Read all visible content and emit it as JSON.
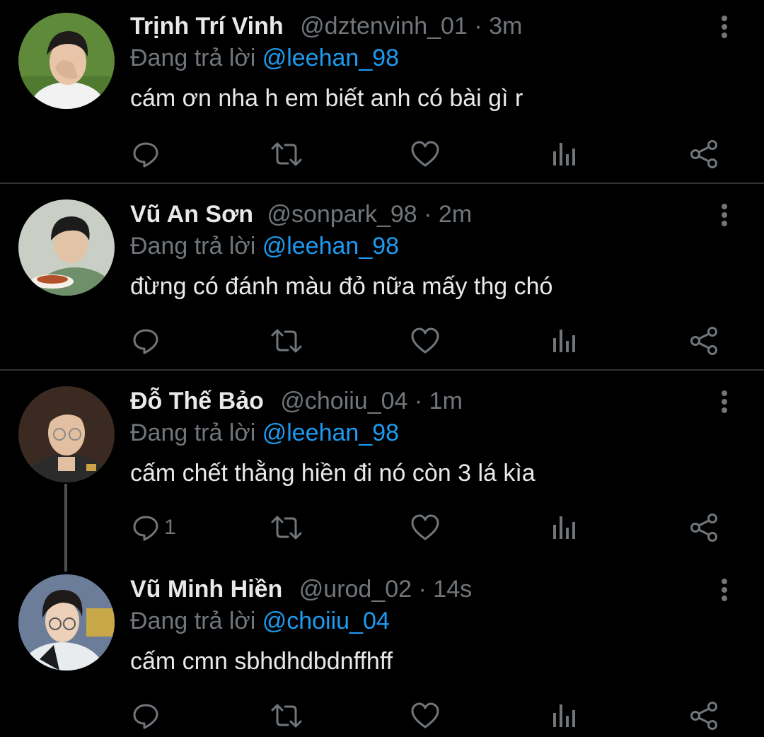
{
  "tweets": [
    {
      "name": "Trịnh Trí Vinh",
      "handle": "@dztenvinh_01",
      "dot": " · ",
      "time": "3m",
      "replying_prefix": "Đang trả lời ",
      "replying_to": "@leehan_98",
      "text": "cám ơn nha h em biết anh có bài gì r",
      "reply_count": "",
      "avatar_colors": {
        "bg": "#5f8a3a",
        "skin": "#e8c5a8",
        "hair": "#1f1b1a",
        "shirt": "#f2f2f2"
      }
    },
    {
      "name": "Vũ An Sơn",
      "handle": "@sonpark_98",
      "dot": " · ",
      "time": "2m",
      "replying_prefix": "Đang trả lời ",
      "replying_to": "@leehan_98",
      "text": "đừng có đánh màu đỏ nữa mấy thg chó",
      "reply_count": "",
      "avatar_colors": {
        "bg": "#c9cfc4",
        "skin": "#e3c3a6",
        "hair": "#1c1c1c",
        "shirt": "#6f8f6a"
      }
    },
    {
      "name": "Đỗ Thế Bảo",
      "handle": "@choiiu_04",
      "dot": " · ",
      "time": "1m",
      "replying_prefix": "Đang trả lời ",
      "replying_to": "@leehan_98",
      "text": "cấm chết thằng hiền đi nó còn 3 lá kìa",
      "reply_count": "1",
      "avatar_colors": {
        "bg": "#3a2a22",
        "skin": "#e2bfa0",
        "hair": "#3b2a22",
        "shirt": "#2b2b2b"
      }
    },
    {
      "name": "Vũ Minh Hiền",
      "handle": "@urod_02",
      "dot": " · ",
      "time": "14s",
      "replying_prefix": "Đang trả lời ",
      "replying_to": "@choiiu_04",
      "text": "cấm cmn sbhdhdbdnffhff",
      "reply_count": "",
      "avatar_colors": {
        "bg": "#6b7d99",
        "skin": "#ecd0b8",
        "hair": "#1e1a1a",
        "shirt": "#e9ecef"
      }
    }
  ],
  "icons": {
    "reply": "reply-icon",
    "retweet": "retweet-icon",
    "like": "heart-icon",
    "analytics": "analytics-icon",
    "share": "share-icon",
    "more": "more-vertical-icon"
  },
  "colors": {
    "background": "#000000",
    "text": "#e7e9ea",
    "secondary": "#71767b",
    "link": "#1d9bf0",
    "divider": "#2f3336",
    "thread_line": "#4a4f54"
  }
}
